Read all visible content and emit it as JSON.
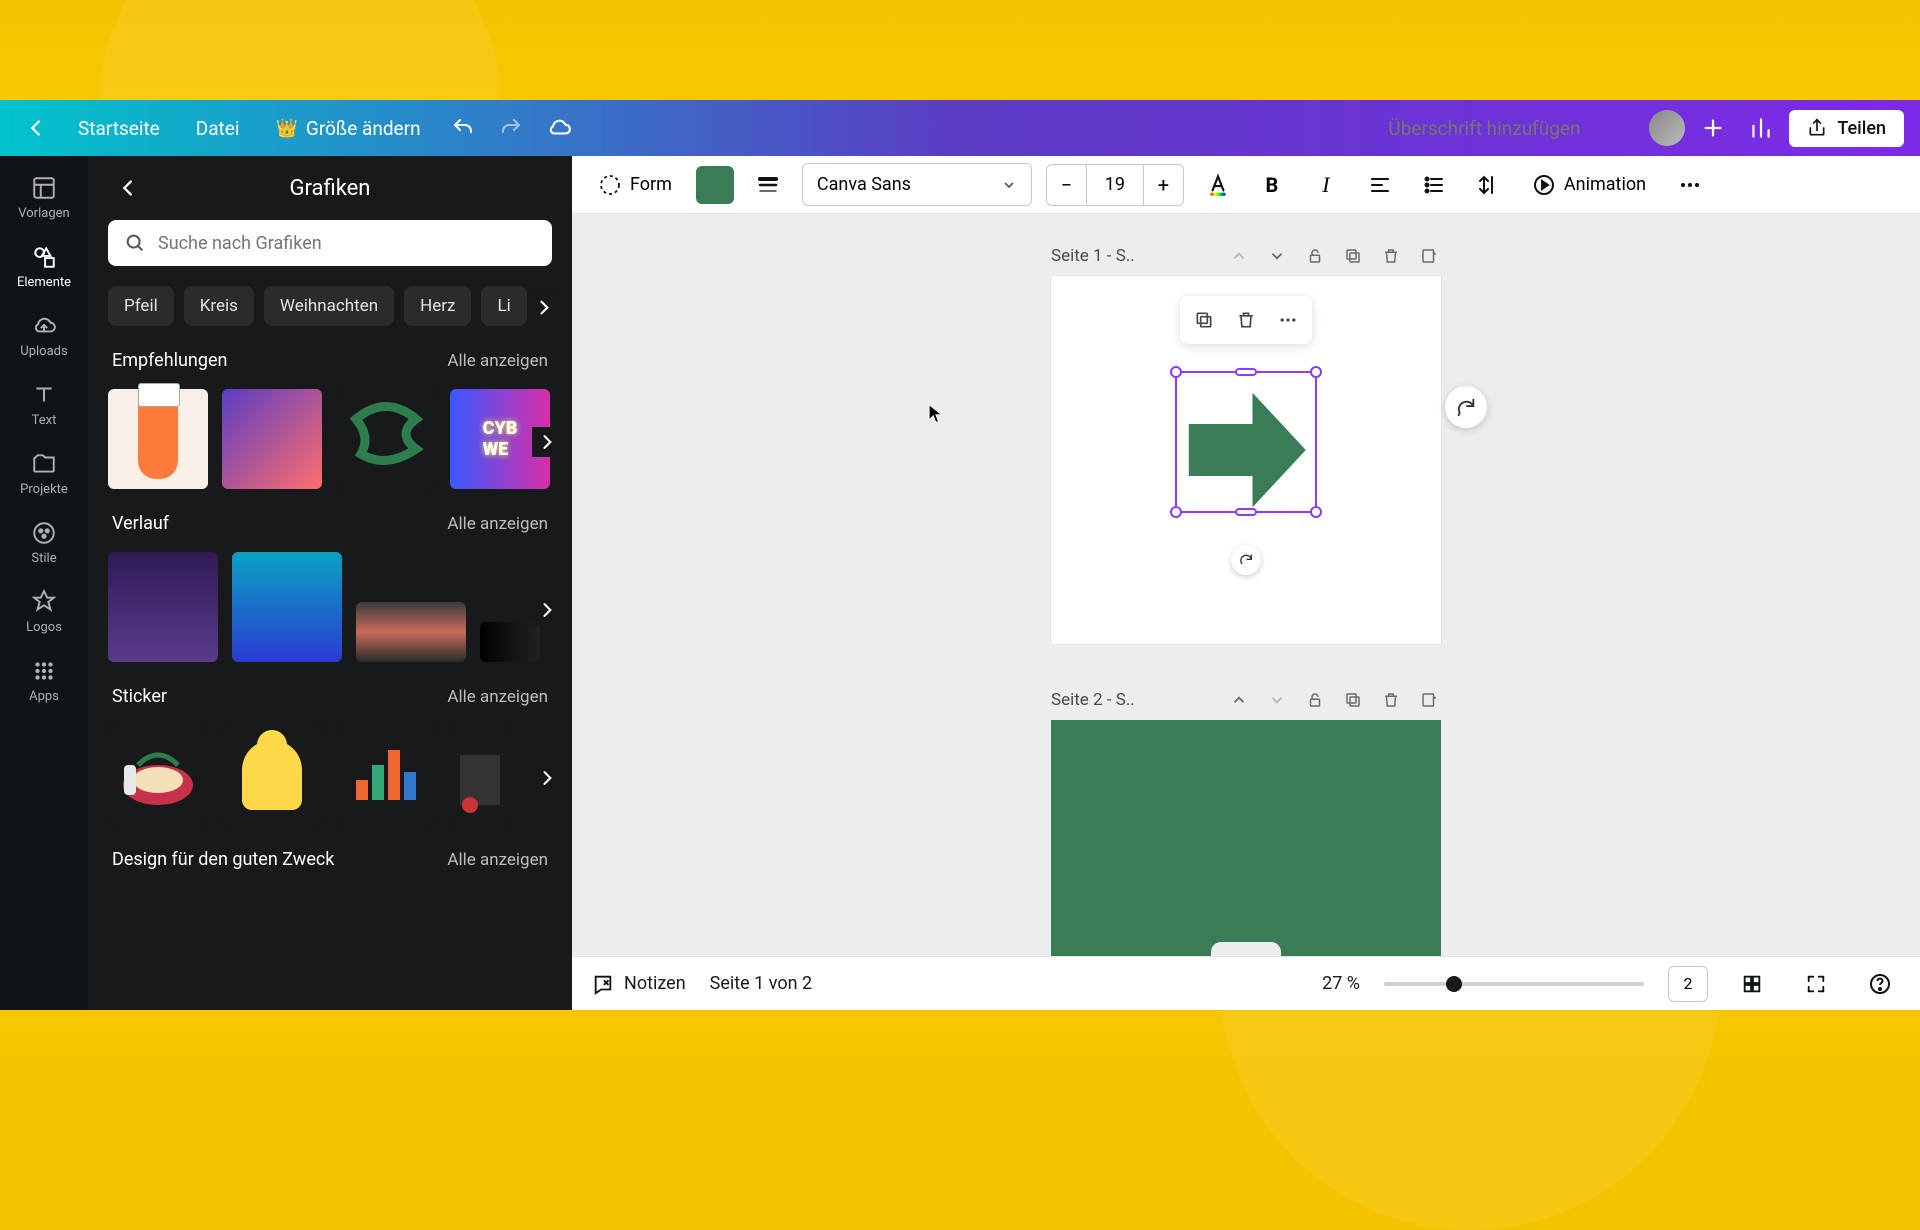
{
  "topbar": {
    "home": "Startseite",
    "file": "Datei",
    "resize": "Größe ändern",
    "title_placeholder": "Überschrift hinzufügen",
    "share": "Teilen"
  },
  "rail": {
    "templates": "Vorlagen",
    "elements": "Elemente",
    "uploads": "Uploads",
    "text": "Text",
    "projects": "Projekte",
    "styles": "Stile",
    "logos": "Logos",
    "apps": "Apps"
  },
  "panel": {
    "title": "Grafiken",
    "search_placeholder": "Suche nach Grafiken",
    "chips": [
      "Pfeil",
      "Kreis",
      "Weihnachten",
      "Herz",
      "Li"
    ],
    "sections": {
      "recommended": "Empfehlungen",
      "gradient": "Verlauf",
      "sticker": "Sticker",
      "good_cause": "Design für den guten Zweck"
    },
    "see_all": "Alle anzeigen"
  },
  "context": {
    "form": "Form",
    "swatch_color": "#3a7c56",
    "font_name": "Canva Sans",
    "font_size": "19",
    "animation": "Animation"
  },
  "canvas": {
    "page1_label": "Seite 1 - S..",
    "page2_label": "Seite 2 - S..",
    "arrow_color": "#3a7c56"
  },
  "bottom": {
    "notes": "Notizen",
    "page_indicator": "Seite 1 von 2",
    "zoom_label": "27 %",
    "page_count": "2"
  }
}
